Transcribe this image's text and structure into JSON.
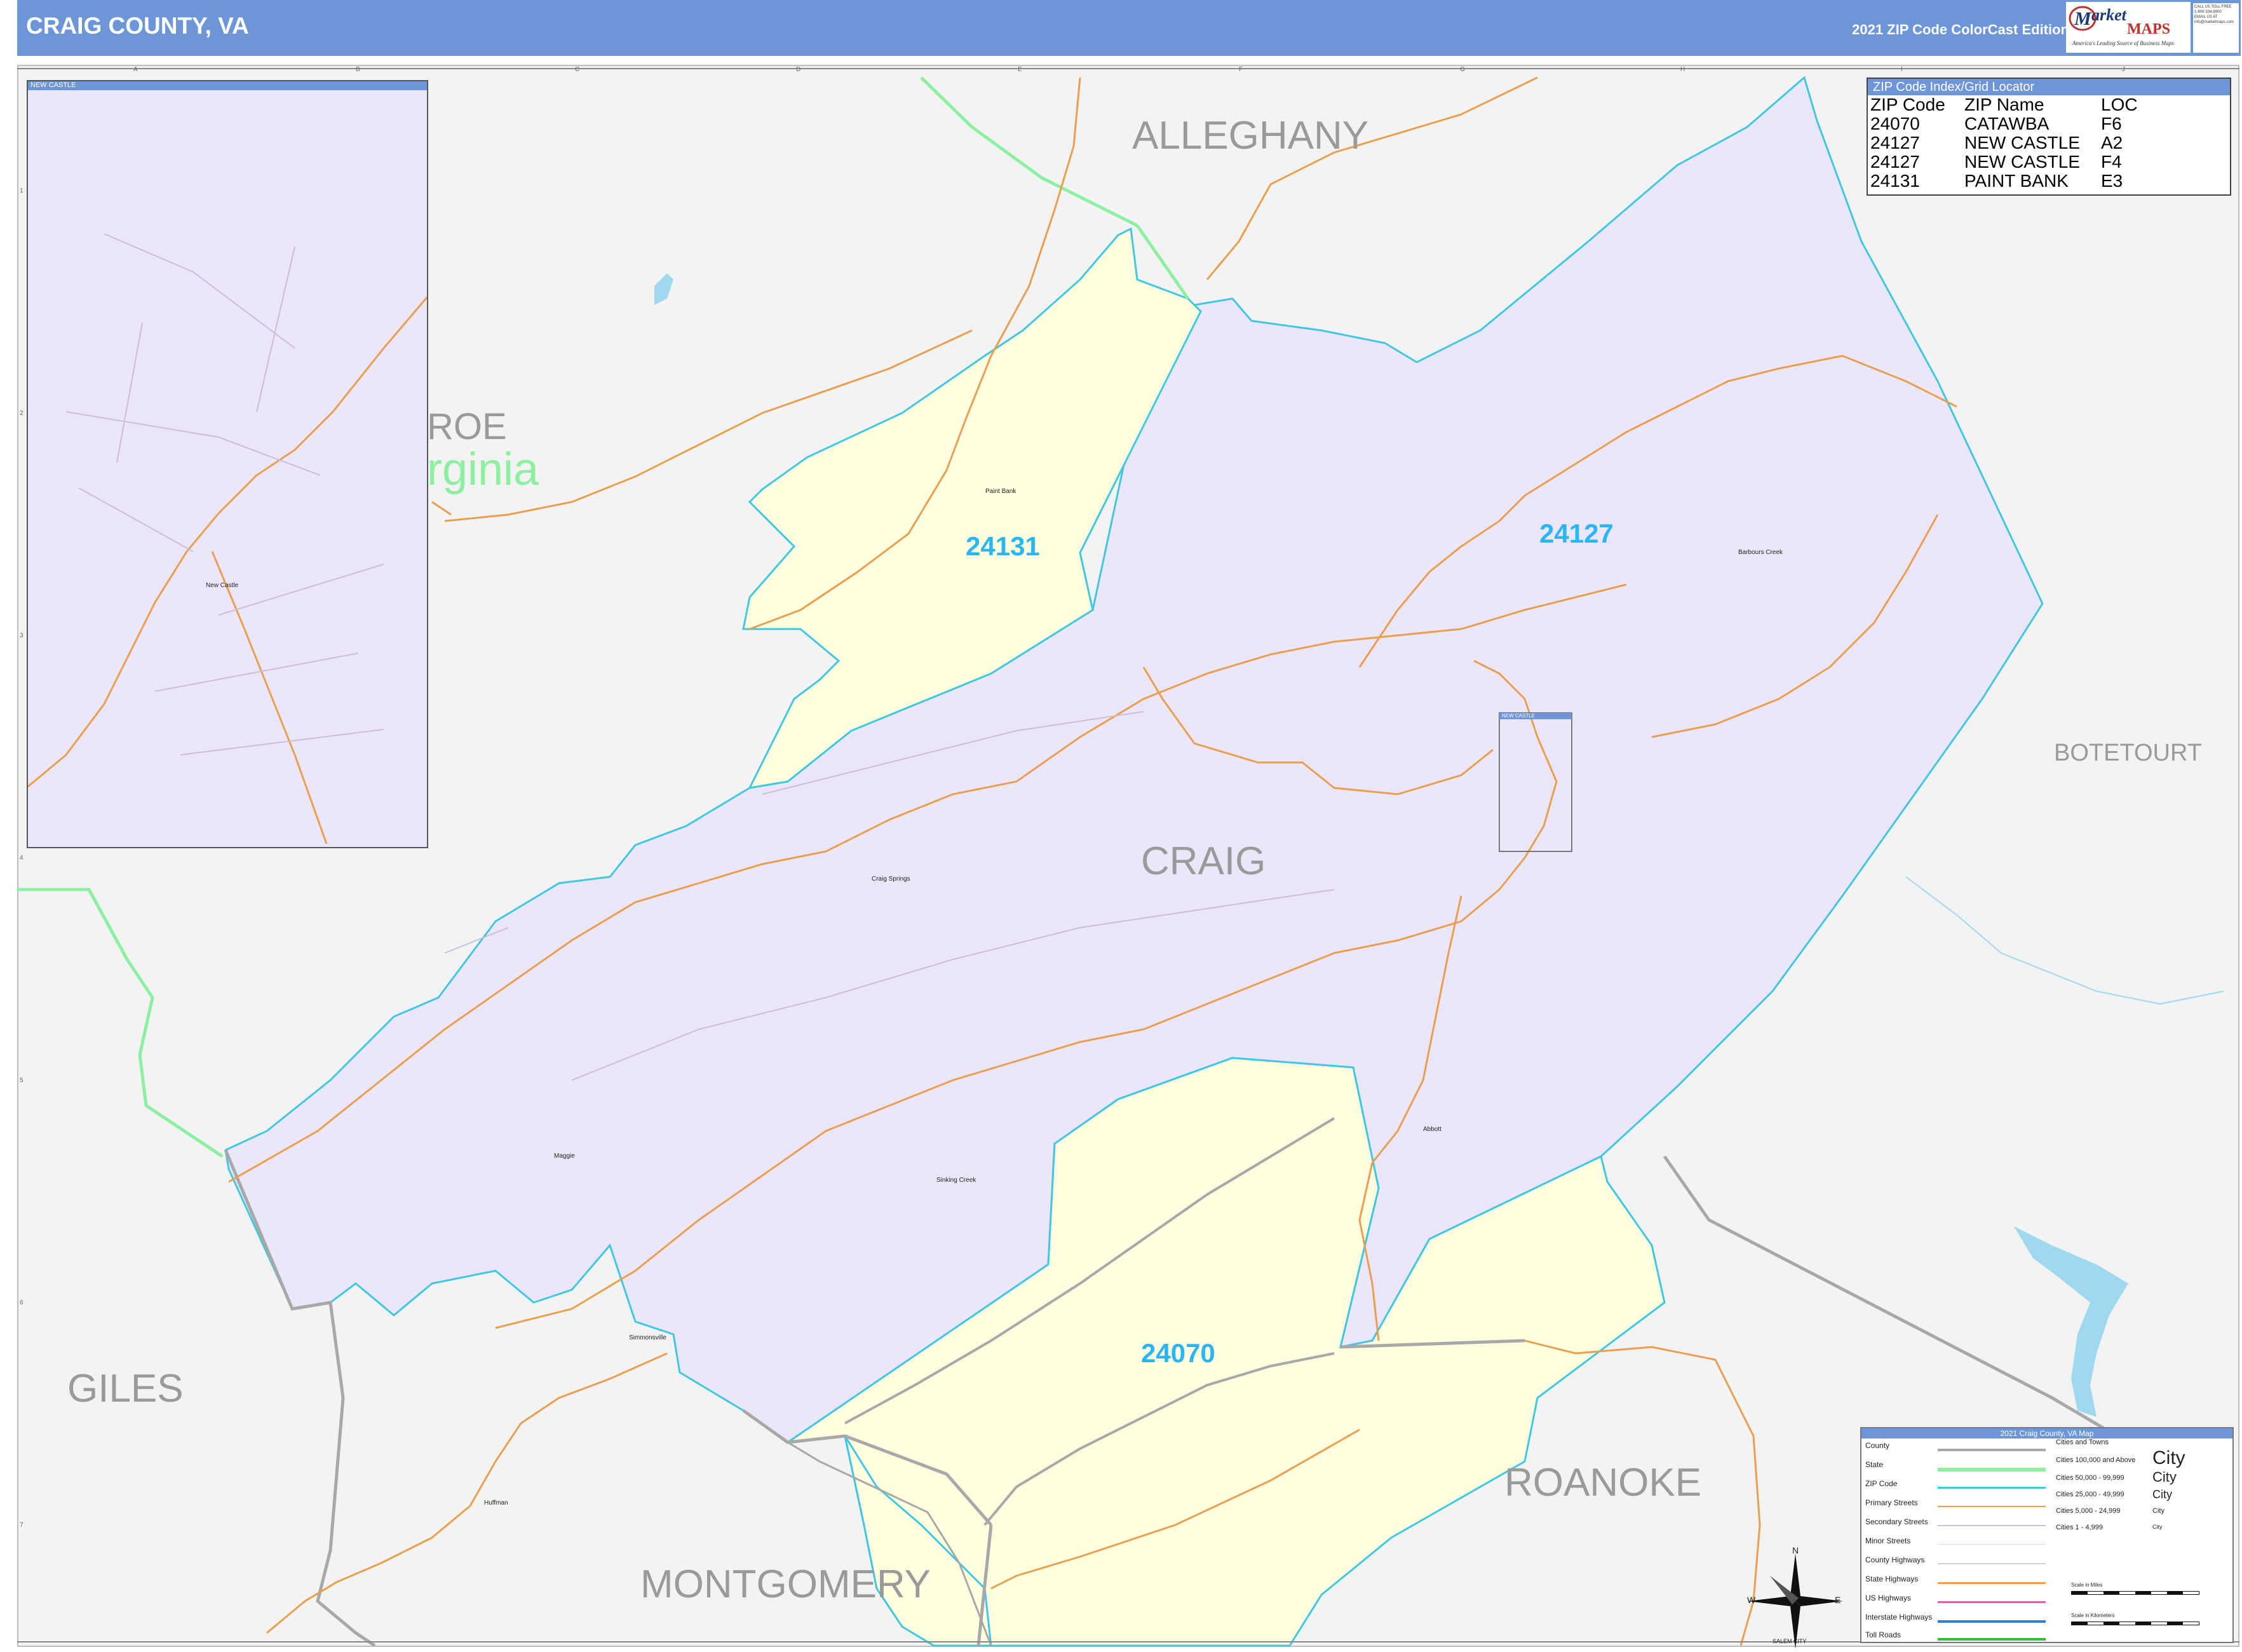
{
  "header": {
    "title": "CRAIG COUNTY, VA",
    "edition": "2021 ZIP Code ColorCast Edition",
    "logo_brand": "arket",
    "logo_brand2": "MAPS",
    "logo_tag": "America's Leading Source of Business Maps",
    "contact_lines": [
      "CALL US TOLL FREE",
      "1-800-334-8900",
      "EMAIL US AT",
      "info@marketmaps.com"
    ]
  },
  "zip_index": {
    "title": "ZIP Code Index/Grid Locator",
    "headers": [
      "ZIP Code",
      "ZIP Name",
      "LOC"
    ],
    "rows": [
      [
        "24070",
        "CATAWBA",
        "F6"
      ],
      [
        "24127",
        "NEW CASTLE",
        "A2"
      ],
      [
        "24127",
        "NEW CASTLE",
        "F4"
      ],
      [
        "24131",
        "PAINT BANK",
        "E3"
      ]
    ]
  },
  "inset": {
    "label": "NEW CASTLE",
    "town": "New Castle"
  },
  "locator_box_label": "NEW CASTLE",
  "counties": {
    "alleghany": "ALLEGHANY",
    "monroe": "ROE",
    "virginia": "rginia",
    "botetourt": "BOTETOURT",
    "craig": "CRAIG",
    "giles": "GILES",
    "roanoke": "ROANOKE",
    "montgomery": "MONTGOMERY"
  },
  "zip_labels": {
    "z24131": "24131",
    "z24127": "24127",
    "z24070": "24070"
  },
  "towns": {
    "paint_bank": "Paint Bank",
    "barbours_creek": "Barbours Creek",
    "craig_springs": "Craig Springs",
    "maggie": "Maggie",
    "sinking_creek": "Sinking Creek",
    "abbott": "Abbott",
    "simmonsville": "Simmonsville",
    "huffman": "Huffman",
    "salem_city": "SALEM CITY"
  },
  "compass": {
    "n": "N",
    "s": "S",
    "e": "E",
    "w": "W"
  },
  "legend": {
    "title": "2021 Craig County, VA Map",
    "layers": [
      "County",
      "State",
      "ZIP Code",
      "Primary Streets",
      "Secondary Streets",
      "Minor Streets",
      "County Highways",
      "State Highways",
      "US Highways",
      "Interstate Highways",
      "Toll Roads"
    ],
    "cities_header": "Cities and Towns",
    "city_classes": [
      "Cities 100,000 and Above",
      "Cities 50,000 - 99,999",
      "Cities 25,000 - 49,999",
      "Cities 5,000 - 24,999",
      "Cities 1 - 4,999"
    ],
    "city_symbols": [
      "City",
      "City",
      "City",
      "City",
      "City"
    ],
    "scale_miles": "Scale in Miles",
    "scale_km": "Scale in Kilometers"
  },
  "grid": {
    "columns": [
      "A",
      "B",
      "C",
      "D",
      "E",
      "F",
      "G",
      "H",
      "I",
      "J"
    ],
    "rows": [
      "1",
      "2",
      "3",
      "4",
      "5",
      "6",
      "7"
    ]
  },
  "colors": {
    "header": "#6d96d8",
    "zip_24127": "#ece6fb",
    "zip_24131_24070": "#ffffdf",
    "zip_boundary": "#40c8e0",
    "state_boundary": "#8cf0a0",
    "county_boundary": "#a8a8a8",
    "road": "#e8a050",
    "water": "#a0d8f0",
    "zip_label": "#29b6f6"
  }
}
